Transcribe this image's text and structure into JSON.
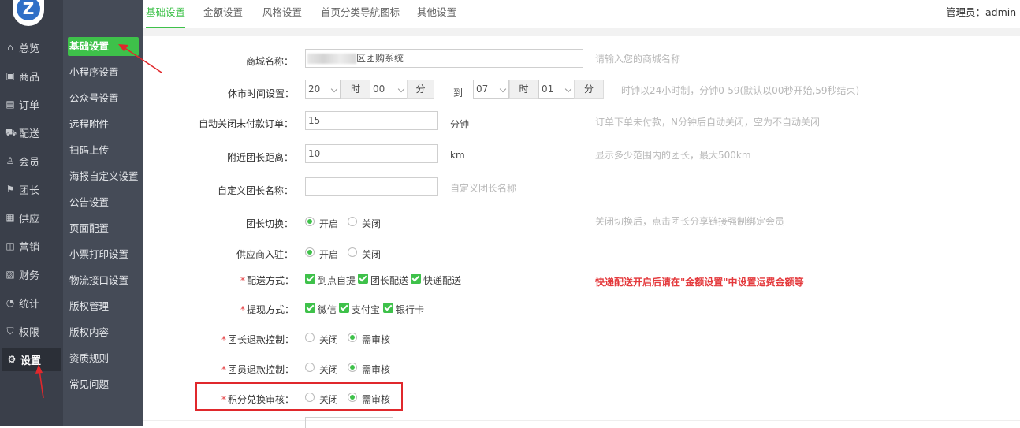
{
  "nav": {
    "logo_letter": "Z",
    "items": [
      {
        "label": "总览",
        "icon": "home-icon",
        "glyph": "⌂"
      },
      {
        "label": "商品",
        "icon": "goods-icon",
        "glyph": "▣"
      },
      {
        "label": "订单",
        "icon": "order-icon",
        "glyph": "▤"
      },
      {
        "label": "配送",
        "icon": "delivery-icon",
        "glyph": "⛟"
      },
      {
        "label": "会员",
        "icon": "member-icon",
        "glyph": "♙"
      },
      {
        "label": "团长",
        "icon": "leader-icon",
        "glyph": "⚑"
      },
      {
        "label": "供应",
        "icon": "supply-icon",
        "glyph": "▦"
      },
      {
        "label": "营销",
        "icon": "marketing-icon",
        "glyph": "◫"
      },
      {
        "label": "财务",
        "icon": "finance-icon",
        "glyph": "▧"
      },
      {
        "label": "统计",
        "icon": "stats-icon",
        "glyph": "◔"
      },
      {
        "label": "权限",
        "icon": "permission-icon",
        "glyph": "⛉"
      },
      {
        "label": "设置",
        "icon": "gear-icon",
        "glyph": "⚙"
      }
    ],
    "active_index": 11
  },
  "subnav": {
    "items": [
      "基础设置",
      "小程序设置",
      "公众号设置",
      "远程附件",
      "扫码上传",
      "海报自定义设置",
      "公告设置",
      "页面配置",
      "小票打印设置",
      "物流接口设置",
      "版权管理",
      "版权内容",
      "资质规则",
      "常见问题"
    ],
    "active_index": 0
  },
  "tabs": {
    "items": [
      "基础设置",
      "金额设置",
      "风格设置",
      "首页分类导航图标",
      "其他设置"
    ],
    "active_index": 0
  },
  "header": {
    "admin_label": "管理员：",
    "admin_name": "admin"
  },
  "form": {
    "shop_name": {
      "label": "商城名称：",
      "value": "区团购系统",
      "hint": "请输入您的商城名称"
    },
    "closing_time": {
      "label": "休市时间设置：",
      "start_hour": "20",
      "start_min": "00",
      "end_hour": "07",
      "end_min": "01",
      "hour_unit": "时",
      "min_unit": "分",
      "to_label": "到",
      "hint": "时钟以24小时制，分钟0-59(默认以00秒开始,59秒结束)"
    },
    "auto_close": {
      "label": "自动关闭未付款订单：",
      "value": "15",
      "unit": "分钟",
      "hint": "订单下单未付款，N分钟后自动关闭，空为不自动关闭"
    },
    "nearby_distance": {
      "label": "附近团长距离：",
      "value": "10",
      "unit": "km",
      "hint": "显示多少范围内的团长，最大500km"
    },
    "custom_leader_name": {
      "label": "自定义团长名称：",
      "value": "",
      "hint": "自定义团长名称"
    },
    "leader_switch": {
      "label": "团长切换：",
      "options": [
        "开启",
        "关闭"
      ],
      "selected": 0,
      "hint": "关闭切换后，点击团长分享链接强制绑定会员"
    },
    "supplier_join": {
      "label": "供应商入驻：",
      "options": [
        "开启",
        "关闭"
      ],
      "selected": 0
    },
    "delivery_method": {
      "required": "*",
      "label": "配送方式：",
      "options": [
        "到点自提",
        "团长配送",
        "快递配送"
      ],
      "warning": "快递配送开启后请在\"金额设置\"中设置运费金额等"
    },
    "withdraw_method": {
      "required": "*",
      "label": "提现方式：",
      "options": [
        "微信",
        "支付宝",
        "银行卡"
      ]
    },
    "leader_refund": {
      "required": "*",
      "label": "团长退款控制：",
      "options": [
        "关闭",
        "需审核"
      ],
      "selected": 1
    },
    "member_refund": {
      "required": "*",
      "label": "团员退款控制：",
      "options": [
        "关闭",
        "需审核"
      ],
      "selected": 1
    },
    "points_exchange": {
      "required": "*",
      "label": "积分兑换审核：",
      "options": [
        "关闭",
        "需审核"
      ],
      "selected": 1
    }
  },
  "colors": {
    "accent": "#3ec14a",
    "nav_bg": "#3a3f4a",
    "subnav_bg": "#454b57",
    "annotation": "#e0282c",
    "warning": "#e4393c"
  }
}
